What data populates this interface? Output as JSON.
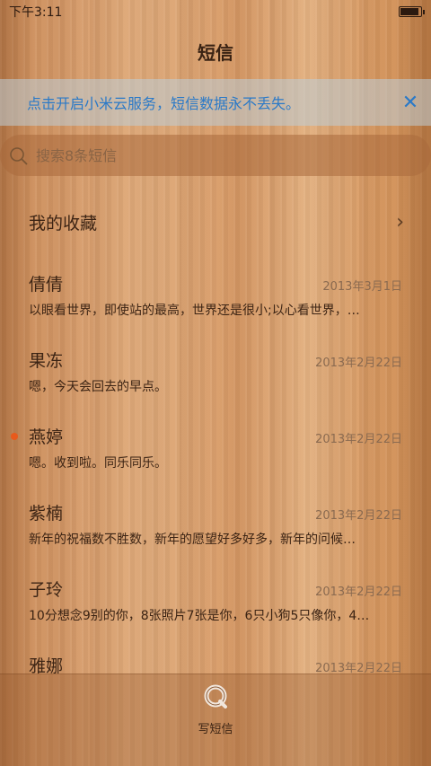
{
  "status": {
    "time": "下午3:11",
    "battery_level": 0.95
  },
  "header": {
    "title": "短信"
  },
  "banner": {
    "text": "点击开启小米云服务，短信数据永不丢失。",
    "close_icon": "close-icon"
  },
  "search": {
    "placeholder": "搜索8条短信",
    "icon": "search-icon"
  },
  "favorites": {
    "label": "我的收藏",
    "icon": "chevron-right-icon"
  },
  "conversations": [
    {
      "name": "倩倩",
      "date": "2013年3月1日",
      "preview": "以眼看世界，即使站的最高，世界还是很小;以心看世界，…",
      "unread": false
    },
    {
      "name": "果冻",
      "date": "2013年2月22日",
      "preview": "嗯，今天会回去的早点。",
      "unread": false
    },
    {
      "name": "燕婷",
      "date": "2013年2月22日",
      "preview": "嗯。收到啦。同乐同乐。",
      "unread": true
    },
    {
      "name": "紫楠",
      "date": "2013年2月22日",
      "preview": "新年的祝福数不胜数，新年的愿望好多好多，新年的问候…",
      "unread": false
    },
    {
      "name": "子玲",
      "date": "2013年2月22日",
      "preview": "10分想念9别的你，8张照片7张是你，6只小狗5只像你，4…",
      "unread": false
    },
    {
      "name": "雅娜",
      "date": "2013年2月22日",
      "preview": "",
      "unread": false
    }
  ],
  "bottom": {
    "compose_label": "写短信",
    "compose_icon": "compose-message-icon"
  },
  "colors": {
    "accent": "#2a79c7",
    "unread_dot": "#e85a1c"
  }
}
